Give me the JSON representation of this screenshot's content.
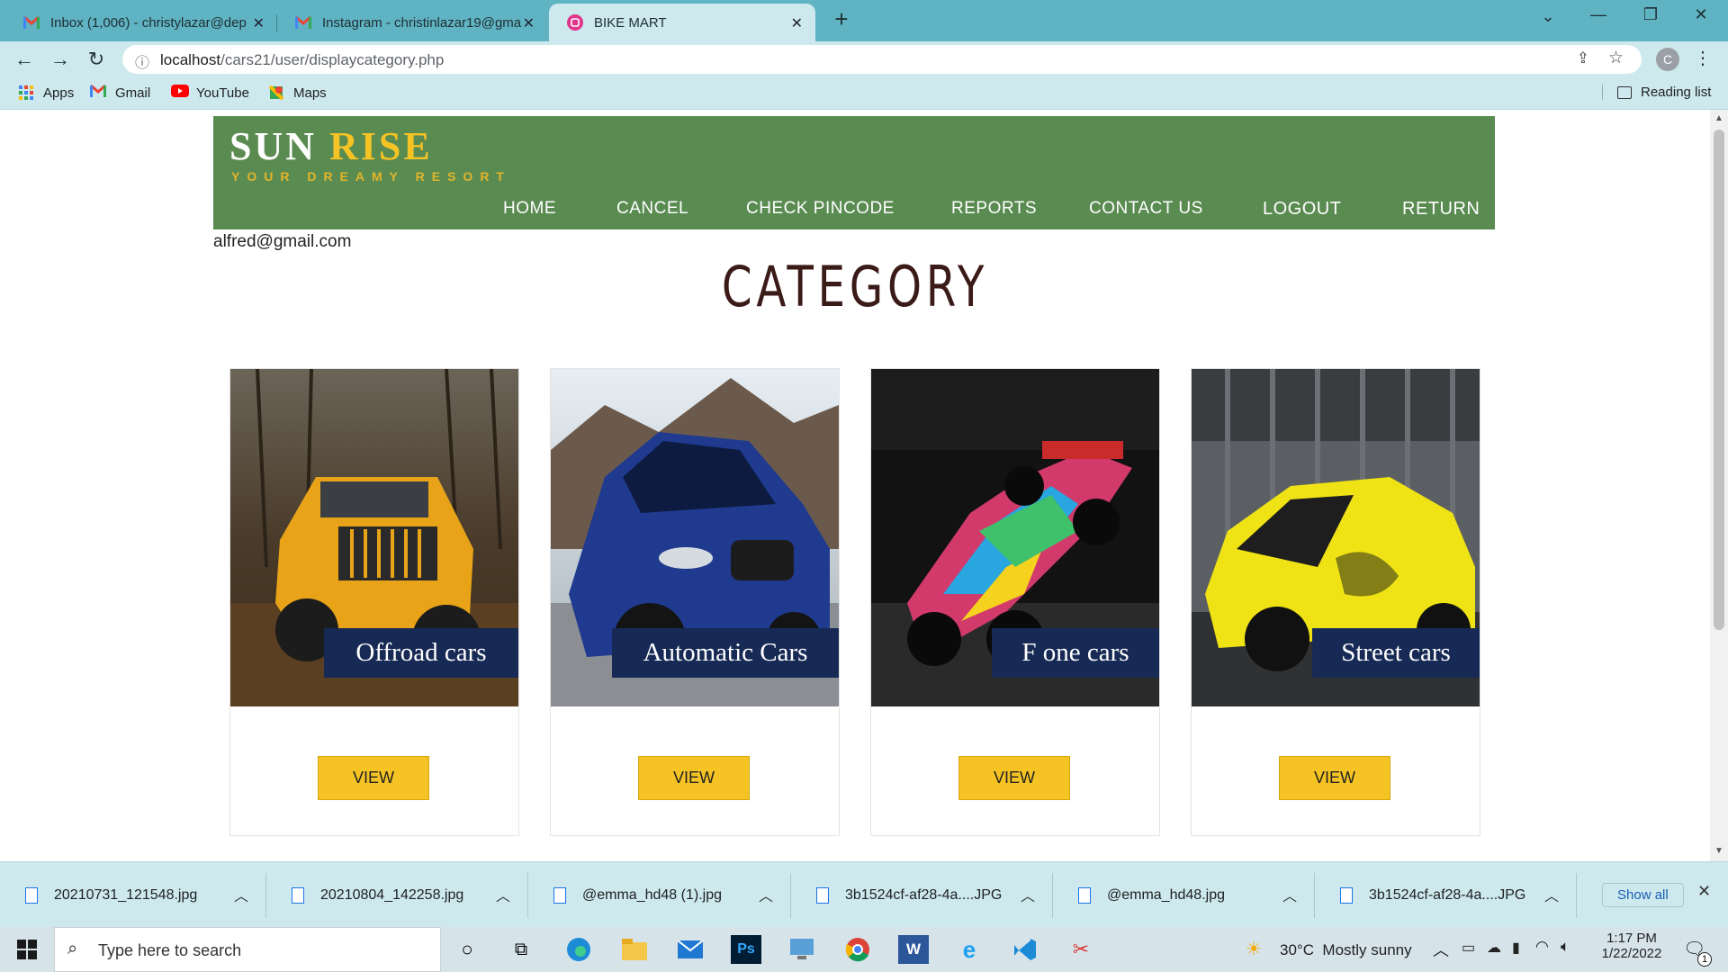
{
  "browser": {
    "tabs": [
      {
        "title": "Inbox (1,006) - christylazar@dep",
        "icon": "gmail-icon"
      },
      {
        "title": "Instagram - christinlazar19@gma",
        "icon": "gmail-icon"
      },
      {
        "title": "BIKE MART",
        "icon": "site-icon",
        "active": true
      }
    ],
    "url_host": "localhost",
    "url_path": "/cars21/user/displaycategory.php",
    "profile_initial": "C",
    "bookmarks": [
      {
        "label": "Apps",
        "icon": "apps-grid-icon"
      },
      {
        "label": "Gmail",
        "icon": "gmail-icon"
      },
      {
        "label": "YouTube",
        "icon": "youtube-icon"
      },
      {
        "label": "Maps",
        "icon": "maps-icon"
      }
    ],
    "reading_list": "Reading list"
  },
  "site": {
    "logo_sun": "SUN",
    "logo_rise": "RISE",
    "tagline": "YOUR DREAMY RESORT",
    "nav": [
      "HOME",
      "CANCEL",
      "CHECK PINCODE",
      "REPORTS",
      "CONTACT US",
      "LOGOUT",
      "RETURN"
    ],
    "user_email": "alfred@gmail.com",
    "page_title": "CATEGORY",
    "cards": [
      {
        "label": "Offroad cars",
        "button": "VIEW",
        "image": "yellow jeep offroad"
      },
      {
        "label": "Automatic Cars",
        "button": "VIEW",
        "image": "blue sedan"
      },
      {
        "label": "F one cars",
        "button": "VIEW",
        "image": "formula one car"
      },
      {
        "label": "Street cars",
        "button": "VIEW",
        "image": "yellow street car"
      }
    ]
  },
  "downloads": {
    "items": [
      "20210731_121548.jpg",
      "20210804_142258.jpg",
      "@emma_hd48 (1).jpg",
      "3b1524cf-af28-4a....JPG",
      "@emma_hd48.jpg",
      "3b1524cf-af28-4a....JPG"
    ],
    "show_all": "Show all"
  },
  "taskbar": {
    "search_placeholder": "Type here to search",
    "weather": "30°C  Mostly sunny",
    "time": "1:17 PM",
    "date": "1/22/2022",
    "notification_count": "1"
  }
}
